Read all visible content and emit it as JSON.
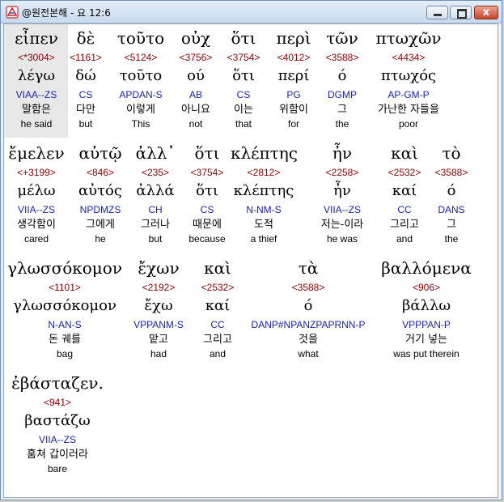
{
  "window": {
    "title": "@원전본해 - 요 12:6",
    "minimize_label": "",
    "maximize_label": "",
    "close_label": "x"
  },
  "rows": [
    {
      "words": [
        {
          "greek": "εἶπεν",
          "num": "<*3004>",
          "lemma": "λέγω",
          "code": "VIAA--ZS",
          "ko": "말함은",
          "en": "he said"
        },
        {
          "greek": "δὲ",
          "num": "<1161>",
          "lemma": "δώ",
          "code": "CS",
          "ko": "다만",
          "en": "but"
        },
        {
          "greek": "τοῦτο",
          "num": "<5124>",
          "lemma": "τοῦτο",
          "code": "APDAN-S",
          "ko": "이렇게",
          "en": "This"
        },
        {
          "greek": "οὐχ",
          "num": "<3756>",
          "lemma": "ού",
          "code": "AB",
          "ko": "아니요",
          "en": "not"
        },
        {
          "greek": "ὅτι",
          "num": "<3754>",
          "lemma": "ὅτι",
          "code": "CS",
          "ko": "이는",
          "en": "that"
        },
        {
          "greek": "περὶ",
          "num": "<4012>",
          "lemma": "περί",
          "code": "PG",
          "ko": "위함이",
          "en": "for"
        },
        {
          "greek": "τῶν",
          "num": "<3588>",
          "lemma": "ό",
          "code": "DGMP",
          "ko": "그",
          "en": "the"
        },
        {
          "greek": "πτωχῶν",
          "num": "<4434>",
          "lemma": "πτωχός",
          "code": "AP-GM-P",
          "ko": "가난한 자들을",
          "en": "poor"
        }
      ]
    },
    {
      "words": [
        {
          "greek": "ἔμελεν",
          "num": "<+3199>",
          "lemma": "μέλω",
          "code": "VIIA--ZS",
          "ko": "생각함이",
          "en": "cared"
        },
        {
          "greek": "αὐτῷ",
          "num": "<846>",
          "lemma": "αὐτός",
          "code": "NPDMZS",
          "ko": "그에게",
          "en": "he"
        },
        {
          "greek": "ἀλλ᾽",
          "num": "<235>",
          "lemma": "ἀλλά",
          "code": "CH",
          "ko": "그러나",
          "en": "but"
        },
        {
          "greek": "ὅτι",
          "num": "<3754>",
          "lemma": "ὅτι",
          "code": "CS",
          "ko": "때문에",
          "en": "because"
        },
        {
          "greek": "κλέπτης",
          "num": "<2812>",
          "lemma": "κλέπτης",
          "code": "N-NM-S",
          "ko": "도적",
          "en": "a thief"
        },
        {
          "greek": "ἦν",
          "num": "<2258>",
          "lemma": "ἦν",
          "code": "VIIA--ZS",
          "ko": "저는-이라",
          "en": "he was"
        },
        {
          "greek": "καὶ",
          "num": "<2532>",
          "lemma": "καί",
          "code": "CC",
          "ko": "그리고",
          "en": "and"
        },
        {
          "greek": "τὸ",
          "num": "<3588>",
          "lemma": "ό",
          "code": "DANS",
          "ko": "그",
          "en": "the"
        }
      ]
    },
    {
      "words": [
        {
          "greek": "γλωσσόκομον",
          "num": "<1101>",
          "lemma": "γλωσσόκομον",
          "code": "N-AN-S",
          "ko": "돈 궤를",
          "en": "bag"
        },
        {
          "greek": "ἔχων",
          "num": "<2192>",
          "lemma": "ἔχω",
          "code": "VPPANM-S",
          "ko": "맡고",
          "en": "had"
        },
        {
          "greek": "καὶ",
          "num": "<2532>",
          "lemma": "καί",
          "code": "CC",
          "ko": "그리고",
          "en": "and"
        },
        {
          "greek": "τὰ",
          "num": "<3588>",
          "lemma": "ό",
          "code": "DANP#NPANZPAPRNN-P",
          "ko": "것을",
          "en": "what"
        },
        {
          "greek": "βαλλόμενα",
          "num": "<906>",
          "lemma": "βάλλω",
          "code": "VPPPAN-P",
          "ko": "거기 넣는",
          "en": "was put therein"
        }
      ]
    },
    {
      "words": [
        {
          "greek": "ἐβάσταζεν.",
          "num": "<941>",
          "lemma": "βαστάζω",
          "code": "VIIA--ZS",
          "ko": "훔쳐 갑이러라",
          "en": "bare"
        }
      ]
    }
  ]
}
